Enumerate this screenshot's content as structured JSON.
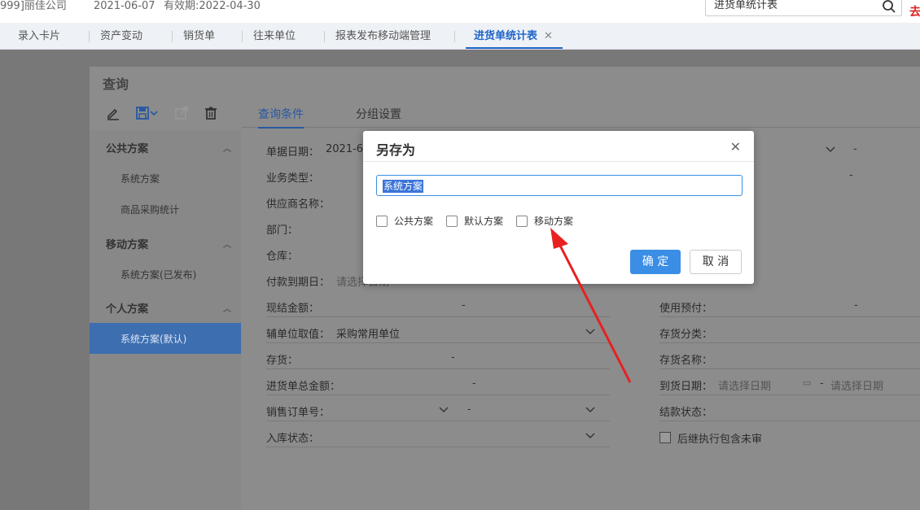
{
  "topbar": {
    "company": "999]丽佳公司",
    "date": "2021-06-07",
    "validity": "有效期:2022-04-30",
    "search_value": "进货单统计表",
    "red_text": "去"
  },
  "tabs": [
    {
      "label": "录入卡片"
    },
    {
      "label": "资产变动"
    },
    {
      "label": "销货单"
    },
    {
      "label": "往来单位"
    },
    {
      "label": "报表发布移动端管理"
    },
    {
      "label": "进货单统计表",
      "active": true
    }
  ],
  "panel": {
    "title": "查询",
    "sidebar": {
      "groups": [
        {
          "label": "公共方案",
          "items": [
            "系统方案",
            "商品采购统计"
          ]
        },
        {
          "label": "移动方案",
          "items": [
            "系统方案(已发布)"
          ]
        },
        {
          "label": "个人方案",
          "items": [
            "系统方案(默认)"
          ]
        }
      ]
    },
    "query_tabs": [
      "查询条件",
      "分组设置"
    ],
    "left_fields": {
      "doc_date": "单据日期：",
      "doc_date_val": "2021-6-",
      "biz_type": "业务类型：",
      "supplier": "供应商名称：",
      "dept": "部门：",
      "warehouse": "仓库：",
      "pay_due": "付款到期日：",
      "pay_due_ph": "请选择日期",
      "cash": "现结金额：",
      "aux_unit": "辅单位取值：",
      "aux_unit_val": "采购常用单位",
      "stock": "存货：",
      "total": "进货单总金额：",
      "sales_order": "销售订单号：",
      "in_status": "入库状态："
    },
    "right_fields": {
      "prepay": "使用预付：",
      "stock_cat": "存货分类：",
      "stock_name": "存货名称：",
      "arrive": "到货日期：",
      "arrive_ph1": "请选择日期",
      "arrive_ph2": "请选择日期",
      "settle": "结款状态：",
      "follow": "后继执行包含未审"
    },
    "dash": "-"
  },
  "dialog": {
    "title": "另存为",
    "input_value": "系统方案",
    "checkboxes": [
      "公共方案",
      "默认方案",
      "移动方案"
    ],
    "ok": "确 定",
    "cancel": "取 消"
  },
  "colors": {
    "accent": "#3a8ee6",
    "arrow": "#e82020"
  }
}
